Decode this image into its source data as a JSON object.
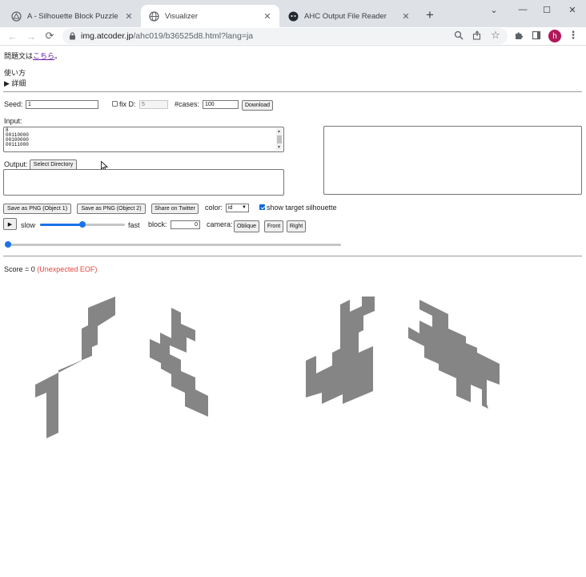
{
  "browser": {
    "tabs": [
      {
        "title": "A - Silhouette Block Puzzle Creat",
        "active": false
      },
      {
        "title": "Visualizer",
        "active": true
      },
      {
        "title": "AHC Output File Reader",
        "active": false
      }
    ],
    "url_host": "img.atcoder.jp",
    "url_path": "/ahc019/b36525d8.html?lang=ja",
    "profile_initial": "h"
  },
  "page": {
    "problem_prefix": "問題文は",
    "problem_link": "こちら",
    "problem_suffix": "。",
    "usage_label": "使い方",
    "details_label": "▶ 詳細",
    "seed_label": "Seed:",
    "seed_value": "1",
    "fixd_label": "fix D:",
    "fixd_value": "5",
    "cases_label": "#cases:",
    "cases_value": "100",
    "download_label": "Download",
    "input_label": "Input:",
    "input_text": "8\n00110000\n00100000\n00111000",
    "output_label": "Output:",
    "select_dir_label": "Select Directory",
    "save_png1_label": "Save as PNG (Object 1)",
    "save_png2_label": "Save as PNG (Object 2)",
    "share_label": "Share on Twitter",
    "color_label": "color:",
    "color_value": "id",
    "show_silhouette_label": "show target silhouette",
    "show_silhouette_checked": true,
    "play_label": "▶",
    "slow_label": "slow",
    "fast_label": "fast",
    "speed_fraction": 0.5,
    "block_label": "block:",
    "block_value": "0",
    "camera_label": "camera:",
    "camera_buttons": [
      "Oblique",
      "Front",
      "Right"
    ],
    "turn_fraction": 0.0,
    "score_text": "Score = 0",
    "error_text": "(Unexpected EOF)"
  },
  "colors": {
    "silhouette": "#858585",
    "link": "#6a1aa8",
    "error": "#e8453c",
    "slider": "#1a73e8",
    "avatar": "#b0185a"
  }
}
